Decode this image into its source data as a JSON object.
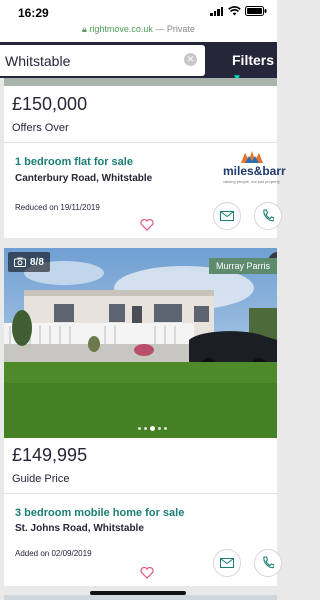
{
  "status": {
    "time": "16:29"
  },
  "browser": {
    "url": "rightmove.co.uk",
    "mode": "Private"
  },
  "search": {
    "value": "Whitstable",
    "filters_label": "Filters"
  },
  "listings": [
    {
      "price": "£150,000",
      "price_qualifier": "Offers Over",
      "property_type": "1 bedroom flat for sale",
      "address": "Canterbury Road, Whitstable",
      "date_note": "Reduced on 19/11/2019",
      "agent": {
        "name": "miles&barr",
        "tagline": "valuing people, not just property"
      }
    },
    {
      "photo_count": "8/8",
      "price": "£149,995",
      "price_qualifier": "Guide Price",
      "property_type": "3 bedroom mobile home for sale",
      "address": "St. Johns Road, Whitstable",
      "date_note": "Added on 02/09/2019",
      "agent": {
        "name": "Murray Parris"
      }
    }
  ],
  "colors": {
    "brand_dark": "#26263a",
    "accent_teal": "#00deb6",
    "link_teal": "#1a7f74"
  }
}
